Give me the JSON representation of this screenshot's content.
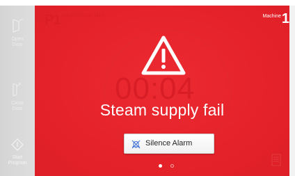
{
  "sidebar": {
    "open_door_label": "Open\nDoor",
    "close_door_label": "Close\nDoor",
    "start_program_label": "Start\nProgram"
  },
  "header": {
    "program_code": "P1",
    "program_name": "Instrument Cycle 134°C",
    "machine_label": "Machine",
    "machine_number": "1"
  },
  "background_timer": "00:04",
  "alarm": {
    "icon": "warning-triangle-icon",
    "message": "Steam supply fail",
    "silence_button_label": "Silence Alarm",
    "silence_icon": "bell-muted-icon"
  },
  "pager": {
    "pages": 2,
    "current": 1
  },
  "colors": {
    "alarm_red": "#e8232c",
    "sidebar_gray": "#d9d9d9",
    "button_bg": "#ffffff",
    "icon_blue": "#3a6fd8"
  }
}
